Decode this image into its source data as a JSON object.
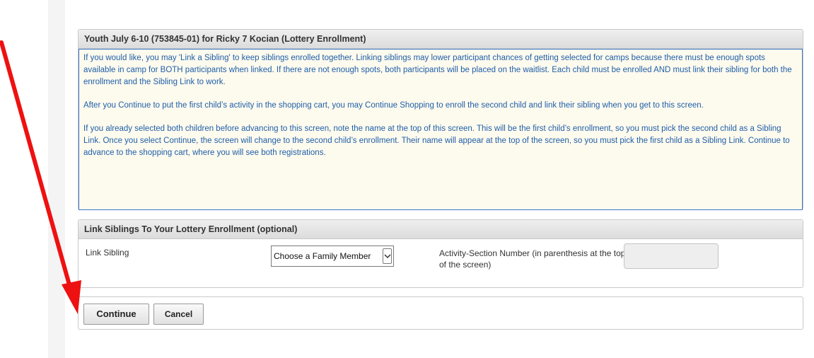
{
  "enrollment_panel": {
    "title": "Youth July 6-10 (753845-01) for Ricky 7 Kocian (Lottery Enrollment)",
    "paragraphs": [
      "If you would like, you may 'Link a Sibling' to keep siblings enrolled together. Linking siblings may lower participant chances of getting selected for camps because there must be enough spots available in camp for BOTH participants when linked. If there are not enough spots, both participants will be placed on the waitlist. Each child must be enrolled AND must link their sibling for both the enrollment and the Sibling Link to work.",
      "After you Continue to put the first child’s activity in the shopping cart, you may Continue Shopping to enroll the second child and link their sibling when you get to this screen.",
      "If you already selected both children before advancing to this screen, note the name at the top of this screen. This will be the first child’s enrollment, so you must pick the second child as a Sibling Link. Once you select Continue, the screen will change to the second child’s enrollment. Their name will appear at the top of the screen, so you must pick the first child as a Sibling Link. Continue to advance to the shopping cart, where you will see both registrations."
    ]
  },
  "link_panel": {
    "title": "Link Siblings To Your Lottery Enrollment (optional)",
    "link_sibling_label": "Link Sibling",
    "family_member_select": "Choose a Family Member",
    "activity_section_label": "Activity-Section Number (in parenthesis at the top of the screen)",
    "activity_section_value": ""
  },
  "buttons": {
    "continue_label": "Continue",
    "cancel_label": "Cancel"
  },
  "annotation": {
    "arrow_color": "#ee1111"
  },
  "colors": {
    "notice_text": "#1f5fa8",
    "notice_border": "#3c78c8",
    "notice_bg": "#fdfaee"
  }
}
